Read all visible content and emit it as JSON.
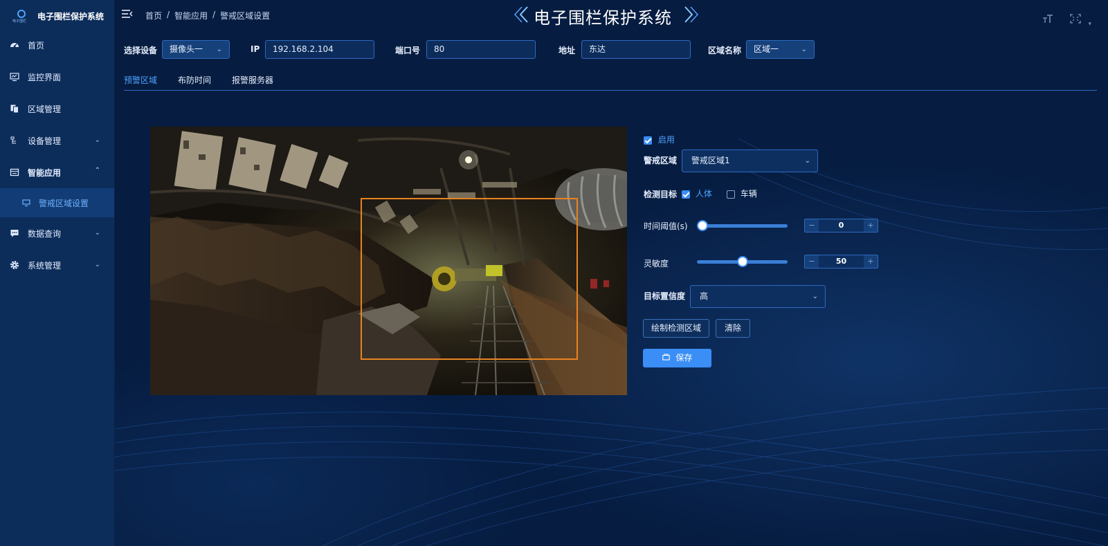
{
  "brand": {
    "title": "电子围栏保护系统",
    "logo_text": "电子围栏"
  },
  "sidebar": {
    "items": [
      {
        "label": "首页",
        "icon": "dashboard-icon"
      },
      {
        "label": "监控界面",
        "icon": "monitor-icon"
      },
      {
        "label": "区域管理",
        "icon": "copy-icon"
      },
      {
        "label": "设备管理",
        "icon": "tree-icon",
        "expandable": true
      },
      {
        "label": "智能应用",
        "icon": "card-icon",
        "expandable": true,
        "expanded": true
      },
      {
        "label": "数据查询",
        "icon": "chat-icon",
        "expandable": true
      },
      {
        "label": "系统管理",
        "icon": "gear-icon",
        "expandable": true
      }
    ],
    "sub_items": [
      {
        "label": "警戒区域设置",
        "icon": "screen-icon",
        "active": true
      }
    ]
  },
  "header": {
    "breadcrumb": [
      "首页",
      "智能应用",
      "警戒区域设置"
    ],
    "separator": "/",
    "title": "电子围栏保护系统"
  },
  "form": {
    "device_label": "选择设备",
    "device_value": "摄像头一",
    "ip_label": "IP",
    "ip_value": "192.168.2.104",
    "port_label": "端口号",
    "port_value": "80",
    "address_label": "地址",
    "address_value": "东达",
    "zone_name_label": "区域名称",
    "zone_name_value": "区域一"
  },
  "tabs": [
    {
      "label": "预警区域",
      "active": true
    },
    {
      "label": "布防时间"
    },
    {
      "label": "报警服务器"
    }
  ],
  "settings": {
    "enable_label": "启用",
    "enable_checked": true,
    "zone_label": "警戒区域",
    "zone_value": "警戒区域1",
    "target_label": "检测目标",
    "target_person_label": "人体",
    "target_person_checked": true,
    "target_vehicle_label": "车辆",
    "target_vehicle_checked": false,
    "time_threshold_label": "时间阈值(s)",
    "time_threshold_value": "0",
    "time_threshold_fraction": 0.0,
    "sensitivity_label": "灵敏度",
    "sensitivity_value": "50",
    "sensitivity_fraction": 0.5,
    "confidence_label": "目标置信度",
    "confidence_value": "高",
    "draw_button": "绘制检测区域",
    "clear_button": "清除",
    "save_button": "保存"
  },
  "colors": {
    "accent": "#3a8ef6",
    "zone_outline": "#e88420",
    "sidebar_bg": "#0c2d5a",
    "main_bg": "#061c40"
  }
}
